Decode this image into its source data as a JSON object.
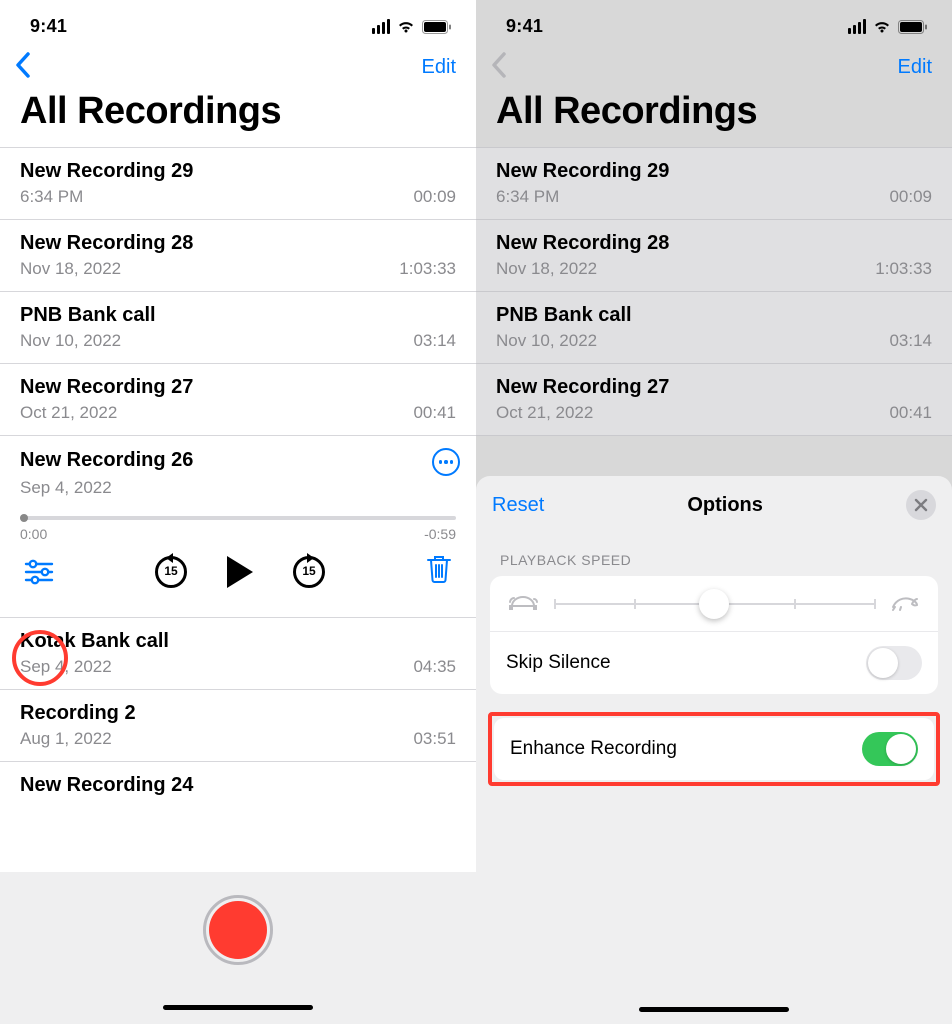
{
  "status": {
    "time": "9:41"
  },
  "nav": {
    "edit": "Edit"
  },
  "title": "All Recordings",
  "recordings": [
    {
      "name": "New Recording 29",
      "date": "6:34 PM",
      "dur": "00:09"
    },
    {
      "name": "New Recording 28",
      "date": "Nov 18, 2022",
      "dur": "1:03:33"
    },
    {
      "name": "PNB Bank call",
      "date": "Nov 10, 2022",
      "dur": "03:14"
    },
    {
      "name": "New Recording 27",
      "date": "Oct 21, 2022",
      "dur": "00:41"
    },
    {
      "name": "New Recording 26",
      "date": "Sep 4, 2022",
      "dur": "00:59"
    },
    {
      "name": "Kotak Bank call",
      "date": "Sep 4, 2022",
      "dur": "04:35"
    },
    {
      "name": "Recording 2",
      "date": "Aug 1, 2022",
      "dur": "03:51"
    },
    {
      "name": "New Recording 24",
      "date": "",
      "dur": ""
    }
  ],
  "player": {
    "elapsed": "0:00",
    "remaining": "-0:59",
    "skip": "15"
  },
  "options": {
    "reset": "Reset",
    "title": "Options",
    "playback_speed_label": "PLAYBACK SPEED",
    "skip_silence": "Skip Silence",
    "enhance_recording": "Enhance Recording"
  }
}
